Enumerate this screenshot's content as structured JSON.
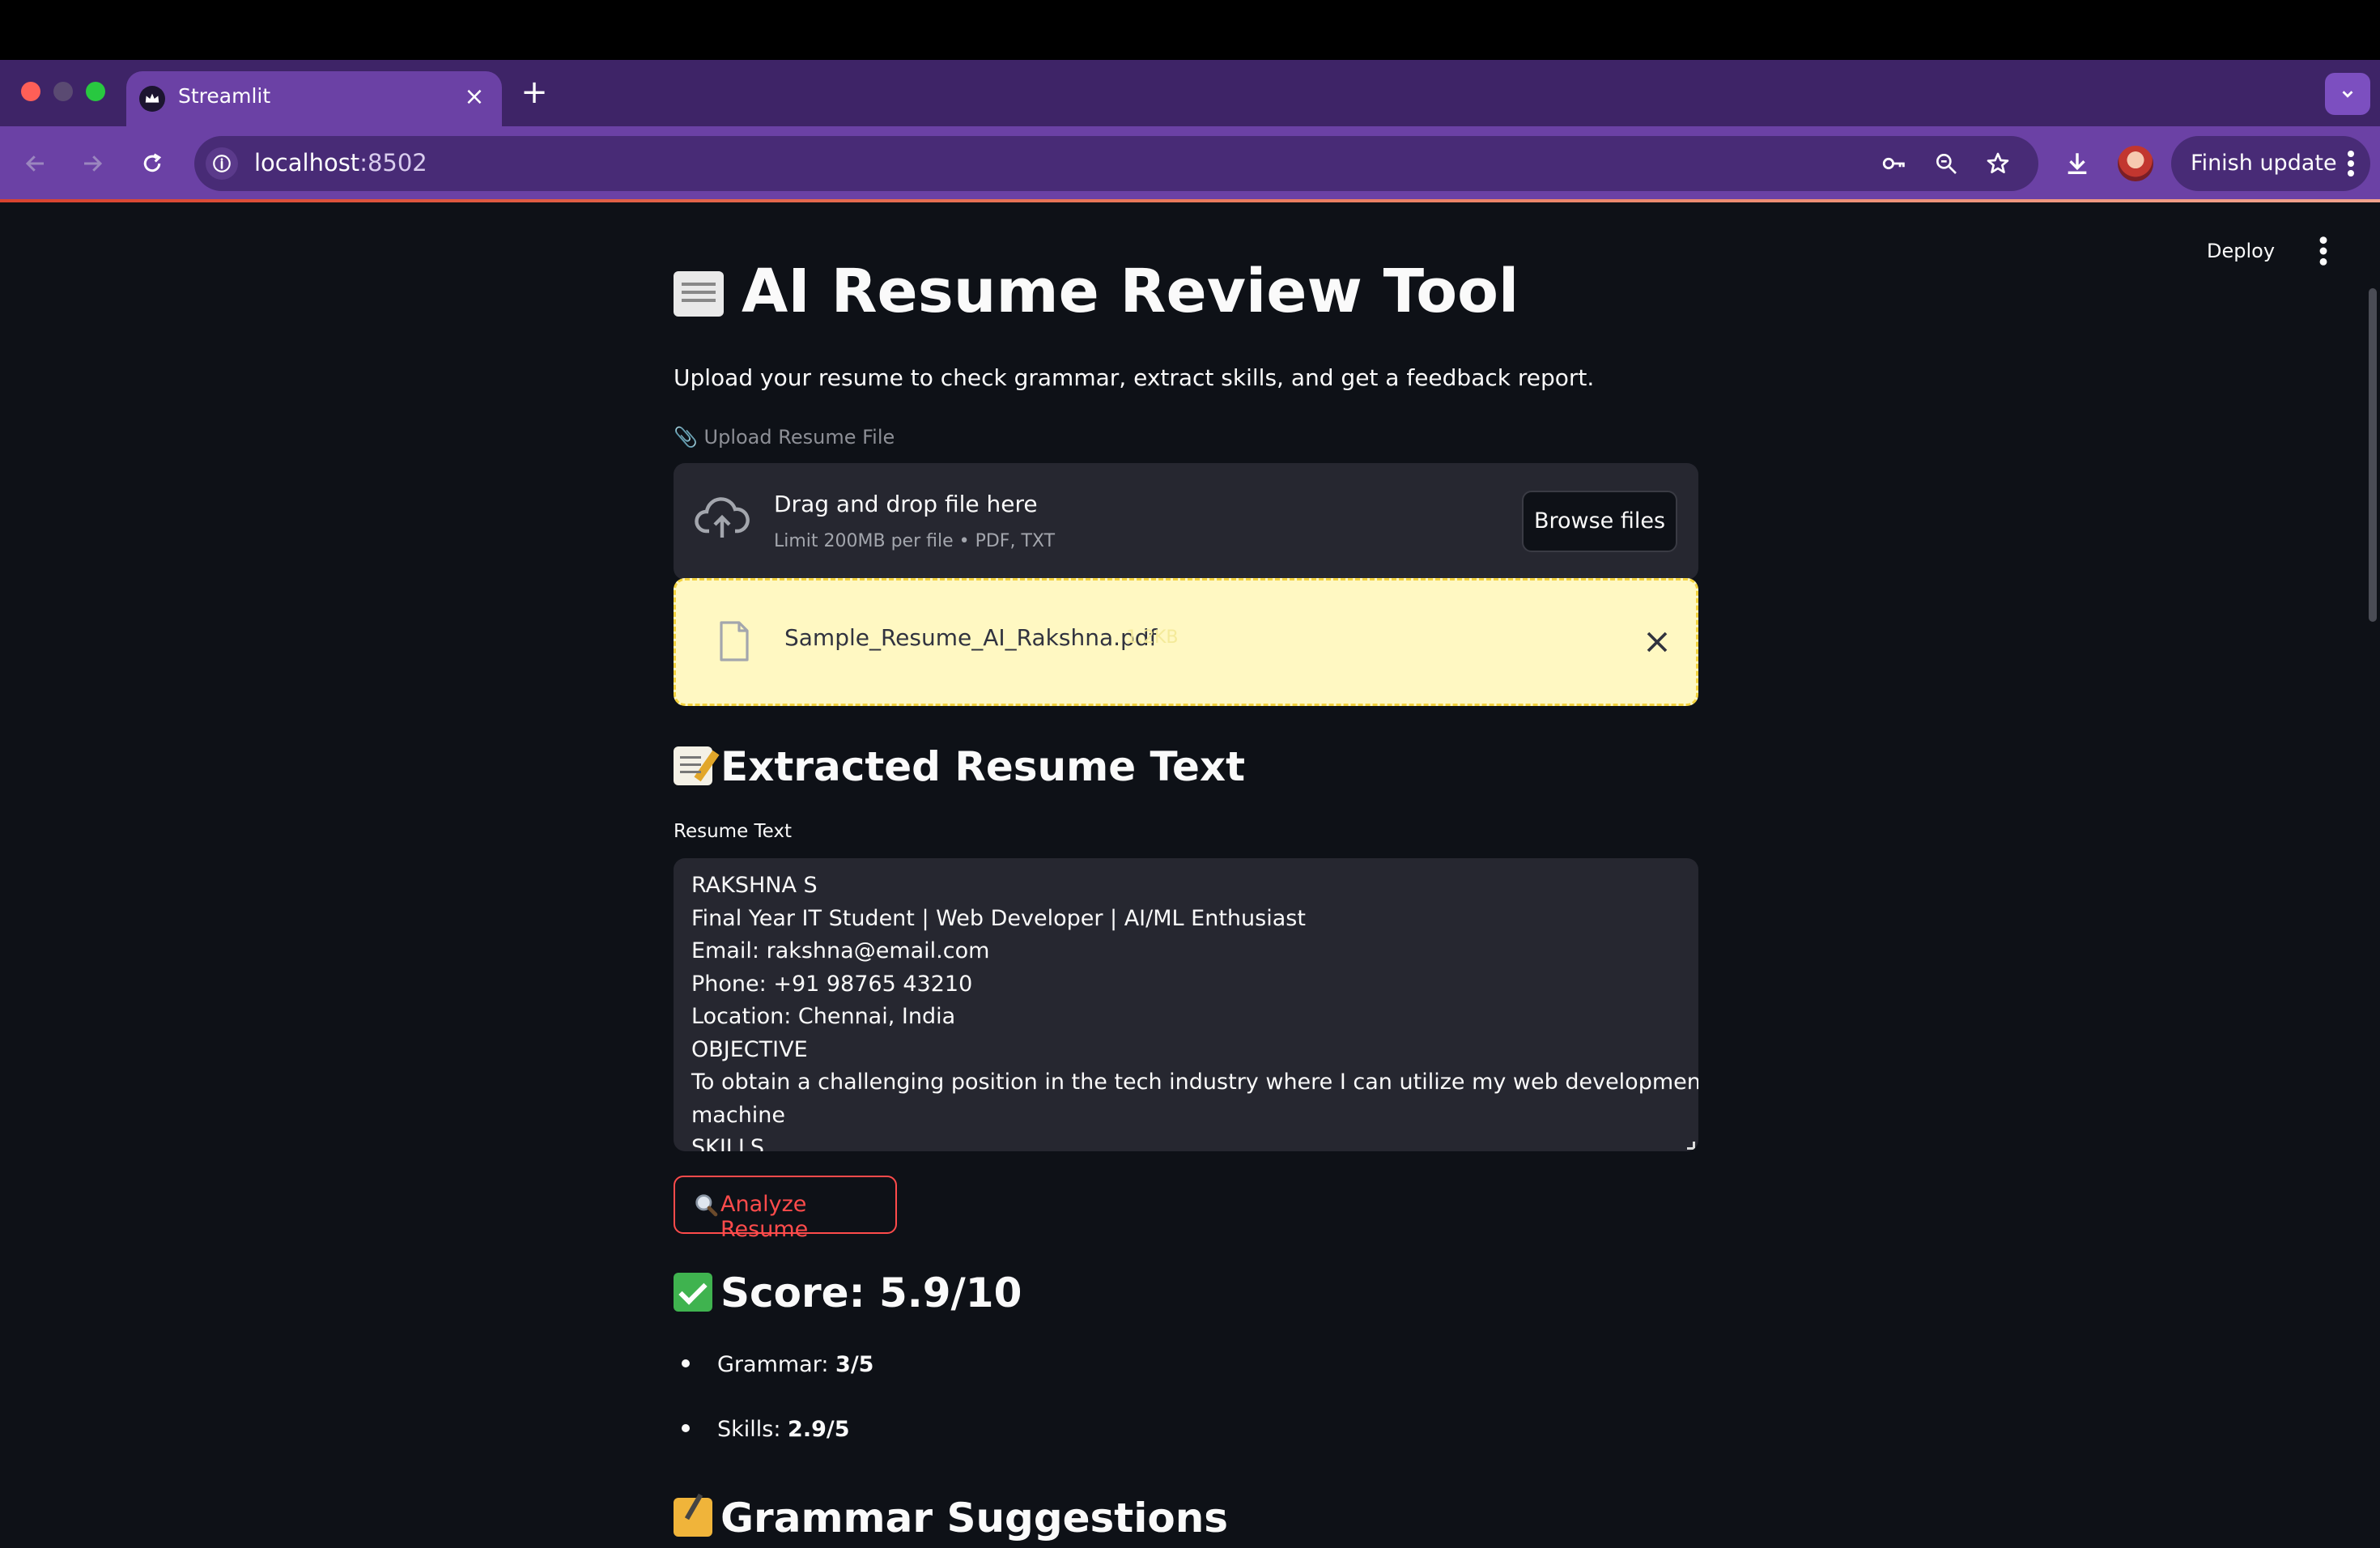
{
  "browser": {
    "tab_title": "Streamlit",
    "new_tab": "+",
    "tab_close": "×",
    "url_host": "localhost",
    "url_port": ":8502",
    "finish_update_label": "Finish update",
    "icons": [
      "back-icon",
      "forward-icon",
      "reload-icon",
      "site-info-icon",
      "password-key-icon",
      "zoom-icon",
      "bookmark-star-icon",
      "download-icon",
      "profile-avatar",
      "more-vertical-icon",
      "tab-search-chevron-icon"
    ]
  },
  "app": {
    "deploy_label": "Deploy",
    "title": "AI Resume Review Tool",
    "subtitle": "Upload your resume to check grammar, extract skills, and get a feedback report.",
    "uploader": {
      "label": "📎 Upload Resume File",
      "drag_text": "Drag and drop file here",
      "limit_text": "Limit 200MB per file • PDF, TXT",
      "browse_label": "Browse files",
      "file_name": "Sample_Resume_AI_Rakshna.pdf",
      "file_size": "1.2KB"
    },
    "extracted": {
      "heading": "Extracted Resume Text",
      "textarea_label": "Resume Text",
      "lines": [
        "RAKSHNA S",
        "Final Year IT Student | Web Developer | AI/ML Enthusiast",
        "Email: rakshna@email.com",
        "Phone: +91 98765 43210",
        "Location: Chennai, India",
        "OBJECTIVE",
        "To obtain a challenging position in the tech industry where I can utilize my web development and",
        "machine",
        "SKILLS"
      ]
    },
    "analyze_label": "Analyze Resume",
    "score": {
      "heading": "Score: 5.9/10",
      "items": [
        {
          "label": "Grammar: ",
          "value": "3/5"
        },
        {
          "label": "Skills: ",
          "value": "2.9/5"
        }
      ]
    },
    "grammar_heading": "Grammar Suggestions"
  }
}
